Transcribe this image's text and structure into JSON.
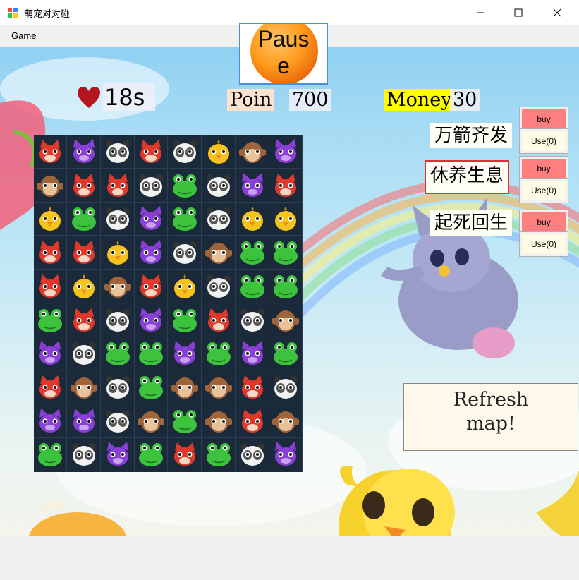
{
  "window": {
    "title": "萌宠对对碰",
    "minimize_glyph": "—",
    "maximize_glyph": "☐",
    "close_glyph": "✕"
  },
  "menu": {
    "items": [
      "Game"
    ]
  },
  "hud": {
    "pause_label": "Pause",
    "timer_value": "18s",
    "points_label": "Poin",
    "points_value": "700",
    "money_label": "Money",
    "money_value": "30"
  },
  "skills": [
    {
      "name": "万箭齐发",
      "buy_label": "buy",
      "use_label": "Use(0)"
    },
    {
      "name": "休养生息",
      "buy_label": "buy",
      "use_label": "Use(0)"
    },
    {
      "name": "起死回生",
      "buy_label": "buy",
      "use_label": "Use(0)"
    }
  ],
  "refresh_label_line1": "Refresh",
  "refresh_label_line2": "map!",
  "board": {
    "rows": 10,
    "cols": 8,
    "pieces": [
      [
        "fox",
        "cat",
        "panda",
        "fox",
        "panda",
        "chick",
        "monkey",
        "cat"
      ],
      [
        "monkey",
        "fox",
        "fox",
        "panda",
        "frog",
        "panda",
        "cat",
        "fox"
      ],
      [
        "chick",
        "frog",
        "panda",
        "cat",
        "frog",
        "panda",
        "chick",
        "chick"
      ],
      [
        "fox",
        "fox",
        "chick",
        "cat",
        "panda",
        "monkey",
        "frog",
        "frog"
      ],
      [
        "fox",
        "chick",
        "monkey",
        "fox",
        "chick",
        "panda",
        "frog",
        "frog"
      ],
      [
        "frog",
        "fox",
        "panda",
        "cat",
        "frog",
        "fox",
        "panda",
        "monkey"
      ],
      [
        "cat",
        "panda",
        "frog",
        "frog",
        "cat",
        "frog",
        "cat",
        "frog"
      ],
      [
        "fox",
        "monkey",
        "panda",
        "frog",
        "monkey",
        "monkey",
        "fox",
        "panda"
      ],
      [
        "cat",
        "cat",
        "panda",
        "monkey",
        "frog",
        "monkey",
        "fox",
        "monkey"
      ],
      [
        "frog",
        "panda",
        "cat",
        "frog",
        "fox",
        "frog",
        "panda",
        "cat"
      ]
    ]
  },
  "colors": {
    "fox": "#e0392b",
    "cat": "#8a3fd6",
    "panda": "#f2f2f2",
    "chick": "#f6c21c",
    "monkey": "#a0643a",
    "frog": "#3cc23c",
    "money_highlight": "#ffff00",
    "points_highlight": "#fde3cf",
    "buy_button": "#ff7f7f",
    "selected_outline": "#e03030"
  }
}
